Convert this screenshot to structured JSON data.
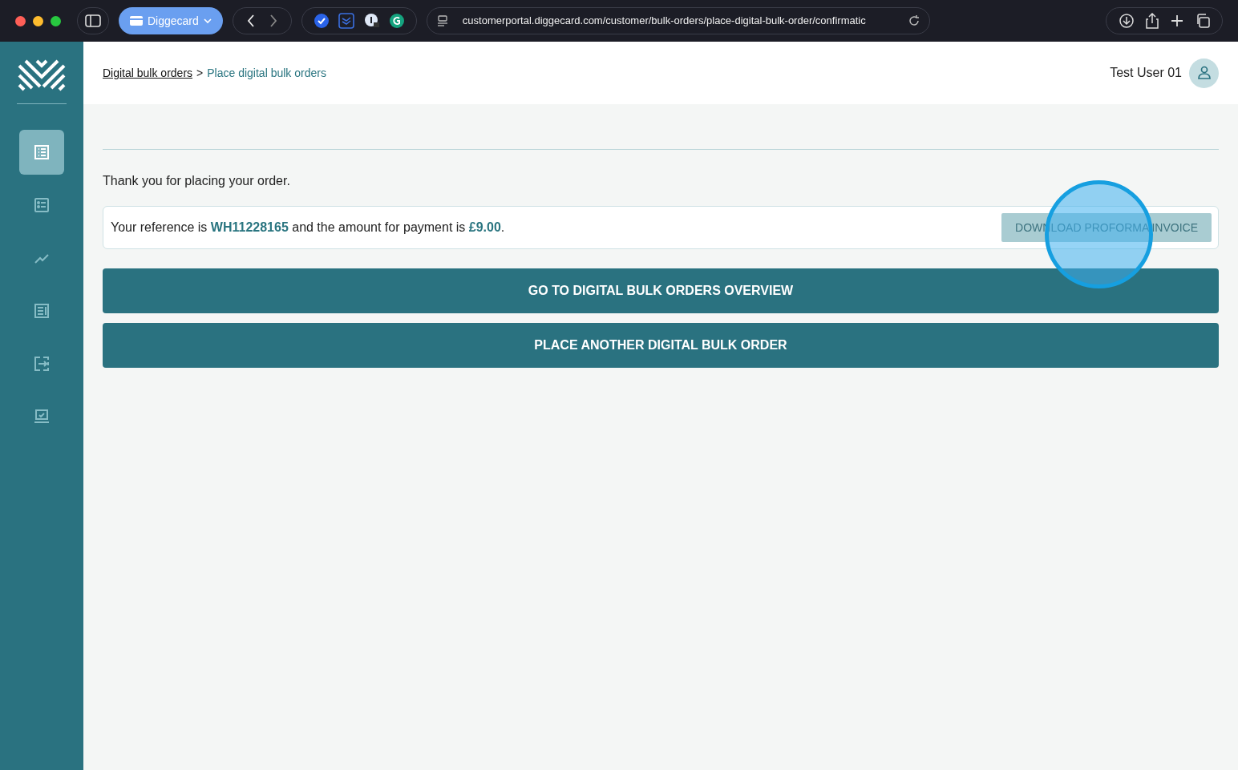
{
  "browser": {
    "tab_group": "Diggecard",
    "url": "customerportal.diggecard.com/customer/bulk-orders/place-digital-bulk-order/confirmatic"
  },
  "sidebar": {
    "items": [
      {
        "kind": "table",
        "selected": true
      },
      {
        "kind": "list",
        "selected": false
      },
      {
        "kind": "chart",
        "selected": false
      },
      {
        "kind": "report",
        "selected": false
      },
      {
        "kind": "transfer",
        "selected": false
      },
      {
        "kind": "laptop",
        "selected": false
      }
    ]
  },
  "header": {
    "breadcrumb": [
      {
        "label": "Digital bulk orders",
        "kind": "link"
      },
      {
        "label": ">",
        "kind": "separator"
      },
      {
        "label": "Place digital bulk orders",
        "kind": "current"
      }
    ],
    "user": "Test User 01"
  },
  "confirmation": {
    "message": "Thank you for placing your order.",
    "reference": "Your reference is **WH11228165** and the amount for payment is **£9.00**.",
    "invoice_button": "DOWNLOAD PROFORMA INVOICE"
  },
  "actions": [
    "GO TO DIGITAL BULK ORDERS OVERVIEW",
    "PLACE ANOTHER DIGITAL BULK ORDER"
  ]
}
